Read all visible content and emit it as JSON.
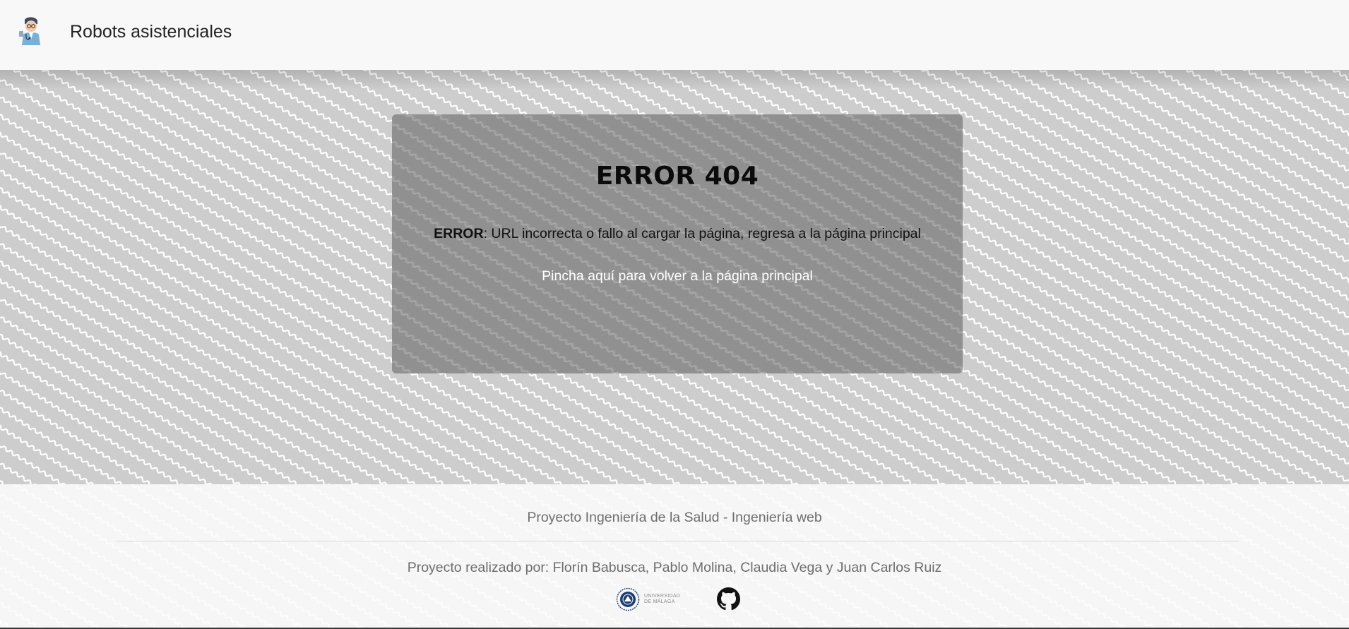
{
  "header": {
    "logo_icon": "robot-doctor-icon",
    "brand": "Robots asistenciales"
  },
  "error_card": {
    "title": "ERROR 404",
    "message_label": "ERROR",
    "message_text": ": URL incorrecta o fallo al cargar la página, regresa a la página principal",
    "back_link": "Pincha aquí",
    "back_text": " para volver a la página principal"
  },
  "footer": {
    "title": "Proyecto Ingeniería de la Salud - Ingeniería web",
    "credits": "Proyecto realizado por: Florín Babusca, Pablo Molina, Claudia Vega y Juan Carlos Ruiz",
    "university_logo_line1": "UNIVERSIDAD",
    "university_logo_line2": "DE MÁLAGA",
    "university_icon": "university-seal-icon",
    "github_icon": "github-icon"
  },
  "colors": {
    "pattern_background": "#cdcdcd",
    "card_background": "#828282",
    "link_color": "#ffffff",
    "footer_text": "#6d6d6d"
  }
}
